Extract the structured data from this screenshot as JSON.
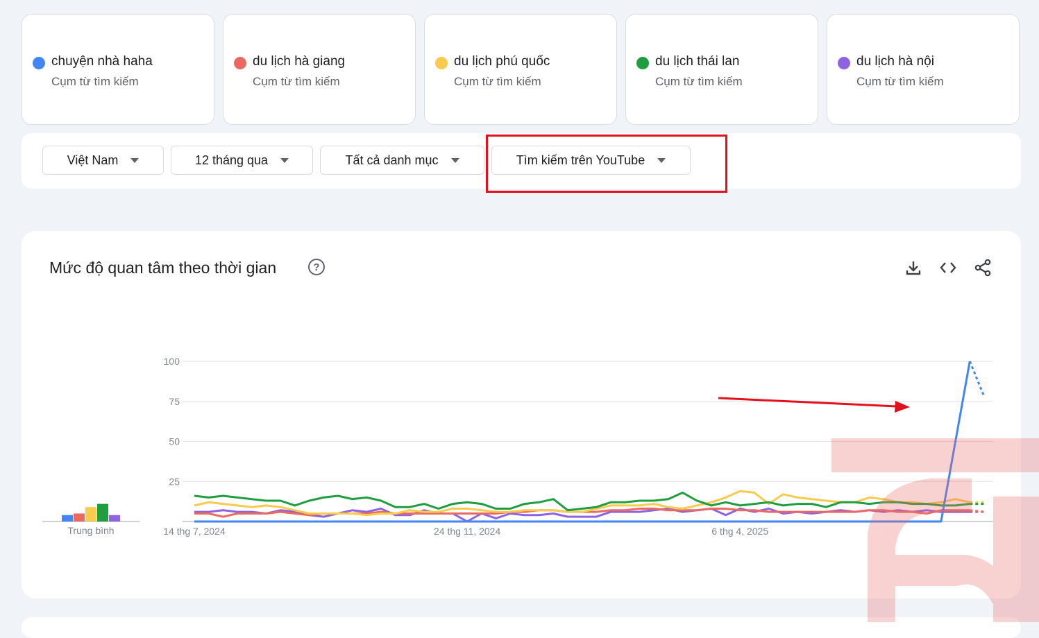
{
  "terms": [
    {
      "name": "chuyện nhà haha",
      "type": "Cụm từ tìm kiếm",
      "color": "#4285f4"
    },
    {
      "name": "du lịch hà giang",
      "type": "Cụm từ tìm kiếm",
      "color": "#ea6a62"
    },
    {
      "name": "du lịch phú quốc",
      "type": "Cụm từ tìm kiếm",
      "color": "#f7cb4d"
    },
    {
      "name": "du lịch thái lan",
      "type": "Cụm từ tìm kiếm",
      "color": "#1e9e3f"
    },
    {
      "name": "du lịch hà nội",
      "type": "Cụm từ tìm kiếm",
      "color": "#8e63e0"
    }
  ],
  "filters": {
    "region": "Việt Nam",
    "time": "12 tháng qua",
    "category": "Tất cả danh mục",
    "search_type": "Tìm kiếm trên YouTube"
  },
  "chart_section": {
    "title": "Mức độ quan tâm theo thời gian",
    "icons": [
      "help-icon",
      "download-icon",
      "embed-code-icon",
      "share-icon"
    ]
  },
  "chart_data": {
    "type": "line",
    "title": "",
    "xlabel": "",
    "ylabel": "",
    "ylim": [
      0,
      100
    ],
    "yticks": [
      0,
      25,
      50,
      75,
      100
    ],
    "ytick_labels": [
      "",
      "25",
      "50",
      "75",
      "100"
    ],
    "x_tick_labels": [
      {
        "label": "14 thg 7, 2024",
        "index": 0
      },
      {
        "label": "24 thg 11, 2024",
        "index": 19
      },
      {
        "label": "6 thg 4, 2025",
        "index": 38
      }
    ],
    "average_label": "Trung bình",
    "averages": [
      4,
      5,
      9,
      11,
      4
    ],
    "partial_last_point": true,
    "series": [
      {
        "name": "chuyện nhà haha",
        "color": "#4285f4",
        "values": [
          0,
          0,
          0,
          0,
          0,
          0,
          0,
          0,
          0,
          0,
          0,
          0,
          0,
          0,
          0,
          0,
          0,
          0,
          0,
          0,
          0,
          0,
          0,
          0,
          0,
          0,
          0,
          0,
          0,
          0,
          0,
          0,
          0,
          0,
          0,
          0,
          0,
          0,
          0,
          0,
          0,
          0,
          0,
          0,
          0,
          0,
          0,
          0,
          0,
          0,
          0,
          0,
          0,
          50,
          100,
          78
        ]
      },
      {
        "name": "du lịch hà giang",
        "color": "#ea6a62",
        "values": [
          5,
          5,
          3,
          5,
          5,
          5,
          6,
          5,
          4,
          5,
          5,
          5,
          5,
          6,
          5,
          5,
          5,
          5,
          5,
          5,
          5,
          5,
          6,
          6,
          7,
          7,
          6,
          6,
          6,
          7,
          7,
          8,
          8,
          7,
          7,
          7,
          8,
          8,
          7,
          7,
          6,
          6,
          6,
          6,
          6,
          6,
          6,
          7,
          7,
          6,
          6,
          5,
          7,
          7,
          7,
          6
        ]
      },
      {
        "name": "du lịch phú quốc",
        "color": "#f7cb4d",
        "values": [
          10,
          12,
          11,
          10,
          9,
          10,
          9,
          7,
          5,
          5,
          5,
          5,
          4,
          5,
          5,
          7,
          6,
          6,
          8,
          8,
          7,
          6,
          6,
          7,
          7,
          7,
          6,
          6,
          8,
          10,
          10,
          10,
          11,
          9,
          8,
          10,
          12,
          15,
          19,
          18,
          11,
          17,
          15,
          14,
          13,
          12,
          12,
          15,
          14,
          12,
          12,
          11,
          12,
          14,
          12,
          12
        ]
      },
      {
        "name": "du lịch thái lan",
        "color": "#1e9e3f",
        "values": [
          16,
          15,
          16,
          15,
          14,
          13,
          13,
          10,
          13,
          15,
          16,
          14,
          15,
          13,
          9,
          9,
          11,
          8,
          11,
          12,
          11,
          8,
          8,
          11,
          12,
          14,
          7,
          8,
          9,
          12,
          12,
          13,
          13,
          14,
          18,
          13,
          10,
          12,
          10,
          11,
          12,
          10,
          11,
          11,
          9,
          12,
          12,
          11,
          12,
          12,
          11,
          11,
          10,
          10,
          11,
          11
        ]
      },
      {
        "name": "du lịch hà nội",
        "color": "#8e63e0",
        "values": [
          6,
          6,
          7,
          6,
          6,
          5,
          7,
          6,
          4,
          3,
          5,
          7,
          6,
          8,
          4,
          4,
          7,
          5,
          5,
          0,
          5,
          2,
          5,
          4,
          4,
          5,
          3,
          3,
          3,
          6,
          6,
          6,
          7,
          8,
          6,
          7,
          8,
          4,
          8,
          6,
          8,
          5,
          6,
          5,
          6,
          7,
          6,
          7,
          6,
          7,
          6,
          7,
          6,
          6,
          6,
          6
        ]
      }
    ]
  }
}
